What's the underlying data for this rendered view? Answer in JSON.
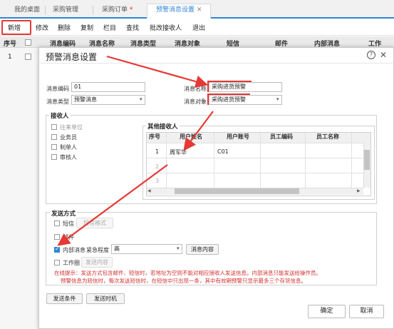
{
  "tabs": [
    {
      "label": "我的桌面",
      "modified": false,
      "active": false
    },
    {
      "label": "采购管理",
      "modified": false,
      "active": false
    },
    {
      "label": "采购订单",
      "modified": true,
      "active": false
    },
    {
      "label": "预警消息设置",
      "modified": false,
      "active": true
    }
  ],
  "toolbar": {
    "new": "新增",
    "modify": "修改",
    "delete": "删除",
    "copy": "复制",
    "columns": "栏目",
    "find": "查找",
    "batch_recipient": "批改接收人",
    "exit": "退出"
  },
  "bg_table": {
    "headers": [
      "序号",
      "消息编码",
      "消息名称",
      "消息类型",
      "消息对象",
      "短信",
      "邮件",
      "内部消息",
      "工作"
    ],
    "rows": [
      {
        "seq": "1"
      }
    ]
  },
  "modal": {
    "title": "预警消息设置",
    "code_label": "消息编码",
    "code_value": "01",
    "name_label": "消息名称",
    "name_value": "采购进货预警",
    "type_label": "消息类型",
    "type_value": "预警消息",
    "object_label": "消息对象",
    "object_value": "采购进货预警",
    "recipients": {
      "legend": "接收人",
      "options": [
        {
          "label": "往来单位",
          "checked": false,
          "disabled": true
        },
        {
          "label": "业务员",
          "checked": false,
          "disabled": false
        },
        {
          "label": "制单人",
          "checked": false,
          "disabled": false
        },
        {
          "label": "审核人",
          "checked": false,
          "disabled": false
        }
      ],
      "other_legend": "其他接收人",
      "grid_headers": [
        "序号",
        "用户姓名",
        "用户账号",
        "员工编码",
        "员工名称"
      ],
      "grid_rows": [
        {
          "seq": "1",
          "user_name": "周军华",
          "account": "C01"
        },
        {
          "seq": "2",
          "user_name": "",
          "account": ""
        },
        {
          "seq": "3",
          "user_name": "",
          "account": ""
        }
      ]
    },
    "send": {
      "legend": "发送方式",
      "sms": "短信",
      "sms_format": "短信格式",
      "email": "邮件",
      "internal": "内部消息",
      "urgency_label": "紧急程度",
      "urgency_value": "高",
      "msg_content": "消息内容",
      "work_circle": "工作圈",
      "send_content": "发送内容"
    },
    "hint1": "在线提示：发送方式包含邮件、短信时，若地址为空则不能对相应接收人发送信息。内部消息只能发送给操作员。",
    "hint2": "预警信息为短信时，每次发送短信时，在短信中只出现一条，其中有效期预警只显示最多三个存货信息。",
    "send_condition": "发送条件",
    "send_time": "发送时机",
    "ok": "确定",
    "cancel": "取消"
  },
  "colors": {
    "accent": "#2e86d6",
    "annotation": "#e53935"
  }
}
